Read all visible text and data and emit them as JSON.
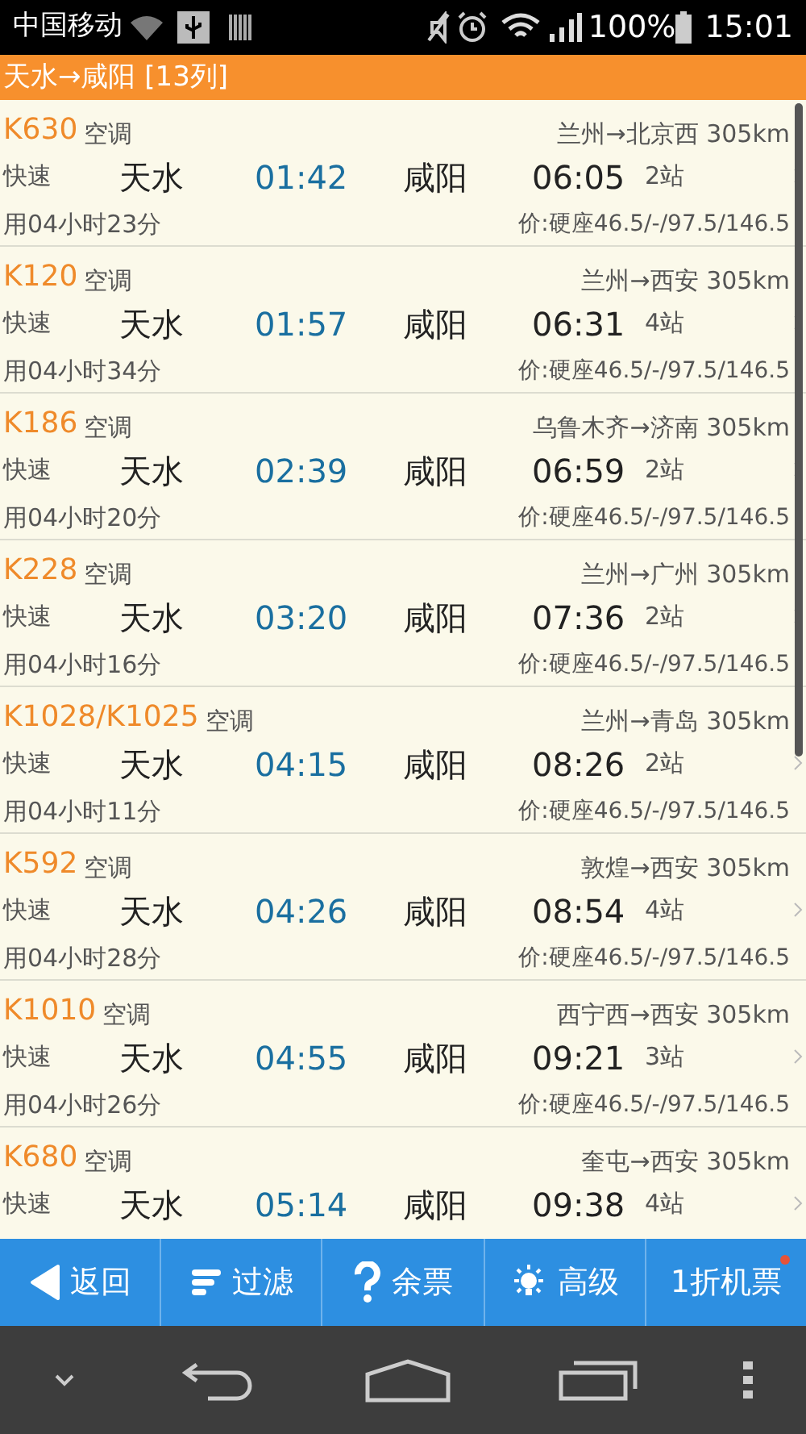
{
  "status_bar": {
    "carrier": "中国移动",
    "battery": "100%",
    "time": "15:01"
  },
  "title": "天水→咸阳 [13列]",
  "trains": [
    {
      "number": "K630",
      "ac": "空调",
      "route": "兰州→北京西 305km",
      "type": "快速",
      "from": "天水",
      "depart": "01:42",
      "to": "咸阳",
      "arrive": "06:05",
      "stops": "2站",
      "duration": "用04小时23分",
      "price": "价:硬座46.5/-/97.5/146.5"
    },
    {
      "number": "K120",
      "ac": "空调",
      "route": "兰州→西安 305km",
      "type": "快速",
      "from": "天水",
      "depart": "01:57",
      "to": "咸阳",
      "arrive": "06:31",
      "stops": "4站",
      "duration": "用04小时34分",
      "price": "价:硬座46.5/-/97.5/146.5"
    },
    {
      "number": "K186",
      "ac": "空调",
      "route": "乌鲁木齐→济南 305km",
      "type": "快速",
      "from": "天水",
      "depart": "02:39",
      "to": "咸阳",
      "arrive": "06:59",
      "stops": "2站",
      "duration": "用04小时20分",
      "price": "价:硬座46.5/-/97.5/146.5"
    },
    {
      "number": "K228",
      "ac": "空调",
      "route": "兰州→广州 305km",
      "type": "快速",
      "from": "天水",
      "depart": "03:20",
      "to": "咸阳",
      "arrive": "07:36",
      "stops": "2站",
      "duration": "用04小时16分",
      "price": "价:硬座46.5/-/97.5/146.5"
    },
    {
      "number": "K1028/K1025",
      "ac": "空调",
      "route": "兰州→青岛 305km",
      "type": "快速",
      "from": "天水",
      "depart": "04:15",
      "to": "咸阳",
      "arrive": "08:26",
      "stops": "2站",
      "duration": "用04小时11分",
      "price": "价:硬座46.5/-/97.5/146.5"
    },
    {
      "number": "K592",
      "ac": "空调",
      "route": "敦煌→西安 305km",
      "type": "快速",
      "from": "天水",
      "depart": "04:26",
      "to": "咸阳",
      "arrive": "08:54",
      "stops": "4站",
      "duration": "用04小时28分",
      "price": "价:硬座46.5/-/97.5/146.5"
    },
    {
      "number": "K1010",
      "ac": "空调",
      "route": "西宁西→西安 305km",
      "type": "快速",
      "from": "天水",
      "depart": "04:55",
      "to": "咸阳",
      "arrive": "09:21",
      "stops": "3站",
      "duration": "用04小时26分",
      "price": "价:硬座46.5/-/97.5/146.5"
    },
    {
      "number": "K680",
      "ac": "空调",
      "route": "奎屯→西安 305km",
      "type": "快速",
      "from": "天水",
      "depart": "05:14",
      "to": "咸阳",
      "arrive": "09:38",
      "stops": "4站"
    }
  ],
  "toolbar": [
    {
      "kind": "back",
      "label": "返回",
      "notification": false
    },
    {
      "kind": "filter",
      "label": "过滤",
      "notification": false
    },
    {
      "kind": "help",
      "label": "余票",
      "notification": false
    },
    {
      "kind": "advanced",
      "label": "高级",
      "notification": false
    },
    {
      "kind": "text",
      "label": "1折机票",
      "notification": true
    }
  ]
}
